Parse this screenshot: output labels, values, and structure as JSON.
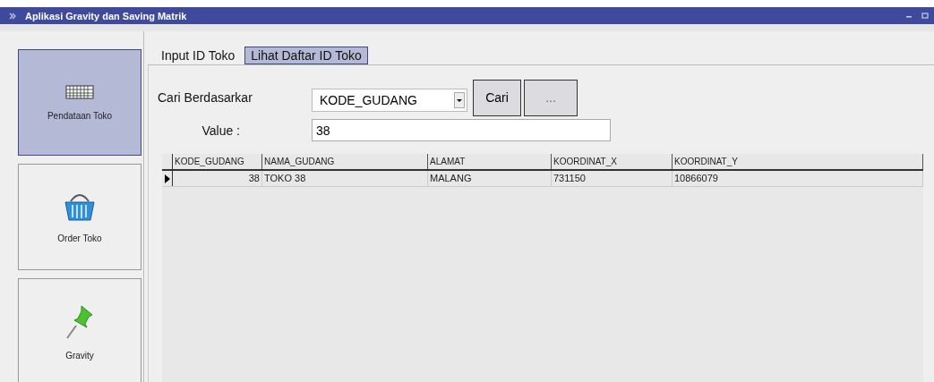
{
  "window": {
    "title": "Aplikasi Gravity dan Saving Matrik"
  },
  "sidebar": {
    "items": [
      {
        "label": "Pendataan Toko",
        "selected": true
      },
      {
        "label": "Order Toko",
        "selected": false
      },
      {
        "label": "Gravity",
        "selected": false
      }
    ]
  },
  "tabs": [
    {
      "label": "Input ID Toko",
      "selected": false
    },
    {
      "label": "Lihat Daftar ID Toko",
      "selected": true
    }
  ],
  "search": {
    "label": "Cari Berdasarkar",
    "field": "KODE_GUDANG",
    "search_button": "Cari",
    "more_button": "...",
    "value_label": "Value :",
    "value": "38"
  },
  "table": {
    "columns": [
      "KODE_GUDANG",
      "NAMA_GUDANG",
      "ALAMAT",
      "KOORDINAT_X",
      "KOORDINAT_Y"
    ],
    "rows": [
      {
        "cells": [
          "38",
          "TOKO 38",
          "MALANG",
          "731150",
          "10866079"
        ],
        "selected": true
      }
    ]
  }
}
